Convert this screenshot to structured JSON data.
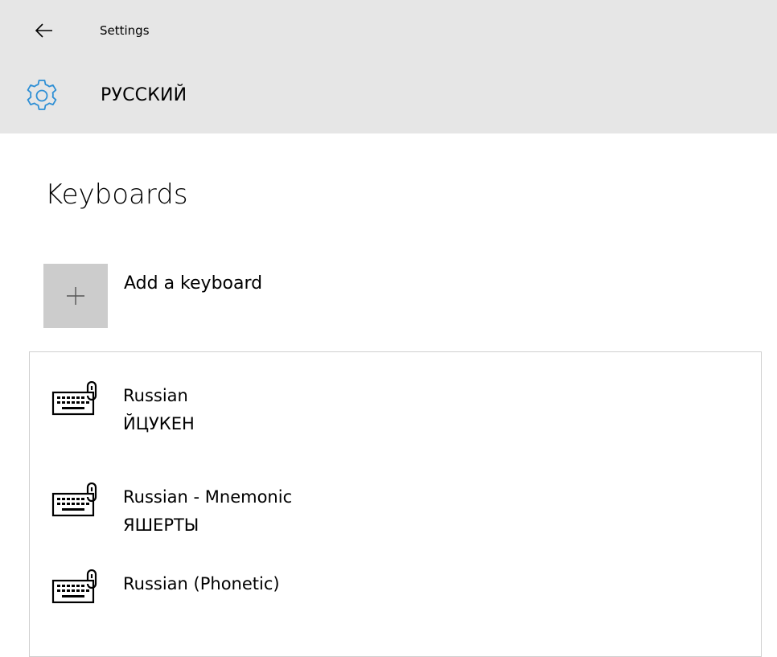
{
  "header": {
    "back_icon": "arrow-left-icon",
    "app_title": "Settings",
    "page_icon": "gear-icon",
    "page_title": "РУССКИЙ"
  },
  "keyboards": {
    "section_title": "Keyboards",
    "add_label": "Add a keyboard",
    "add_icon": "plus-icon",
    "items": [
      {
        "name": "Russian",
        "layout": "ЙЦУКЕН",
        "icon": "keyboard-icon"
      },
      {
        "name": "Russian - Mnemonic",
        "layout": "ЯШЕРТЫ",
        "icon": "keyboard-icon"
      },
      {
        "name": "Russian (Phonetic)",
        "layout": "",
        "icon": "keyboard-icon"
      }
    ]
  },
  "colors": {
    "header_bg": "#e6e6e6",
    "accent": "#2e8fd5",
    "add_tile_bg": "#cccccc",
    "list_border": "#cfcfcf"
  }
}
